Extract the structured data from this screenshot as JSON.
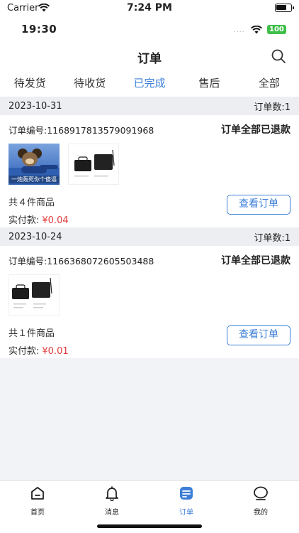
{
  "os_status": {
    "carrier": "Carrier",
    "time": "7:24 PM"
  },
  "inner_status": {
    "time": "19:30",
    "dots": "....",
    "battery": "100"
  },
  "nav": {
    "title": "订单"
  },
  "tabs": [
    {
      "label": "待发货"
    },
    {
      "label": "待收货"
    },
    {
      "label": "已完成"
    },
    {
      "label": "售后"
    },
    {
      "label": "全部"
    }
  ],
  "active_tab": "已完成",
  "groups": [
    {
      "date": "2023-10-31",
      "count_label": "订单数:1",
      "order_no": "订单编号:1168917813579091968",
      "status": "订单全部已退款",
      "meme_caption": "一炮轰死你个傻逼",
      "summary": "共４件商品",
      "paid_label": "实付款:",
      "paid_amount": "¥0.04",
      "button": "查看订单"
    },
    {
      "date": "2023-10-24",
      "count_label": "订单数:1",
      "order_no": "订单编号:1166368072605503488",
      "status": "订单全部已退款",
      "summary": "共１件商品",
      "paid_label": "实付款:",
      "paid_amount": "¥0.01",
      "button": "查看订单"
    }
  ],
  "tabbar": [
    {
      "label": "首页",
      "icon": "home-icon"
    },
    {
      "label": "消息",
      "icon": "bell-icon"
    },
    {
      "label": "订单",
      "icon": "order-icon"
    },
    {
      "label": "我的",
      "icon": "profile-icon"
    }
  ],
  "colors": {
    "accent": "#3d7fd8",
    "price": "#e23b3b",
    "group_bg": "#eceef1"
  }
}
